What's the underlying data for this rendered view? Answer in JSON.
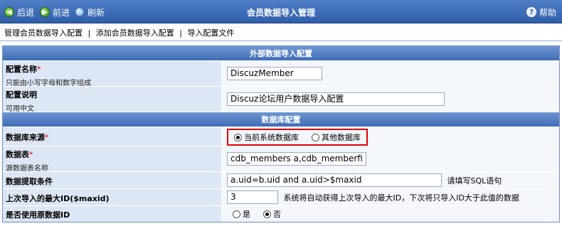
{
  "toolbar": {
    "back_label": "后退",
    "forward_label": "前进",
    "refresh_label": "刷新",
    "title": "会员数据导入管理",
    "help_label": "帮助"
  },
  "links": [
    "管理会员数据导入配置",
    "添加会员数据导入配置",
    "导入配置文件"
  ],
  "link_separator": "|",
  "form": {
    "section_external": "外部数据导入配置",
    "section_database": "数据库配置",
    "config_name": {
      "label": "配置名称",
      "required_mark": "*",
      "hint": "只能由小写字母和数字组成",
      "value": "DiscuzMember"
    },
    "config_desc": {
      "label": "配置说明",
      "hint": "可用中文",
      "value": "Discuz论坛用户数据导入配置"
    },
    "db_source": {
      "label": "数据库来源",
      "required_mark": "*",
      "options": [
        "当前系统数据库",
        "其他数据库"
      ],
      "selected": "当前系统数据库"
    },
    "data_table": {
      "label": "数据表",
      "required_mark": "*",
      "hint": "源数据表名称",
      "value": "cdb_members a,cdb_memberfi"
    },
    "fetch_condition": {
      "label": "数据提取条件",
      "value": "a.uid=b.uid and a.uid>$maxid",
      "note": "请填写SQL语句"
    },
    "last_max_id": {
      "label": "上次导入的最大ID($maxid)",
      "value": "3",
      "note": "系统将自动获得上次导入的最大ID，下次将只导入ID大于此值的数据"
    },
    "use_original_id": {
      "label": "是否使用原数据ID",
      "options": [
        "是",
        "否"
      ],
      "selected": "否"
    }
  }
}
